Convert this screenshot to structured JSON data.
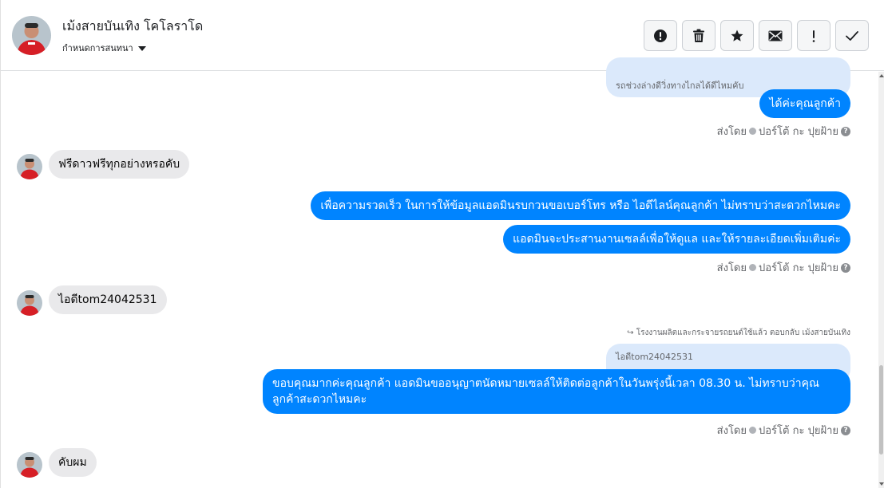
{
  "header": {
    "contact_name": "เม้งสายบันเทิง โคโลราโด",
    "assign_label": "กำหนดการสนทนา"
  },
  "toolbar": [
    {
      "icon": "alert-circle-icon",
      "name": "report-spam-button"
    },
    {
      "icon": "trash-icon",
      "name": "delete-button"
    },
    {
      "icon": "star-icon",
      "name": "star-button"
    },
    {
      "icon": "envelope-icon",
      "name": "mark-unread-button"
    },
    {
      "icon": "exclamation-icon",
      "name": "follow-up-button"
    },
    {
      "icon": "check-icon",
      "name": "mark-done-button"
    }
  ],
  "messages": {
    "quote_top": "รถช่วงล่างดีวิ่งทางไกลได้ดีไหมคับ",
    "out_1": "ได้ค่ะคุณลูกค้า",
    "in_1": "ฟรีดาวฟรีทุกอย่างหรอคับ",
    "out_2": "เพื่อความรวดเร็ว ในการให้ข้อมูลแอดมินรบกวนขอเบอร์โทร หรือ ไอดีไลน์คุณลูกค้า ไม่ทราบว่าสะดวกไหมคะ",
    "out_3": "แอดมินจะประสานงานเซลล์เพื่อให้ดูแล และให้รายละเอียดเพิ่มเติมค่ะ",
    "in_2": "ไอดีtom24042531",
    "reply_note": "โรงงานผลิตและกระจายรถยนต์ใช้แล้ว ตอบกลับ เม้งสายบันเทิง",
    "quote_2": "ไอดีtom24042531",
    "out_4": "ขอบคุณมากค่ะคุณลูกค้า แอดมินขออนุญาตนัดหมายเซลล์ให้ติดต่อลูกค้าในวันพรุ่งนี้เวลา 08.30 น. ไม่ทราบว่าคุณลูกค้าสะดวกไหมคะ",
    "in_3": "คับผม"
  },
  "sent_by": {
    "prefix": "ส่งโดย",
    "agent": "ปอร์โต้ กะ ปุยฝ้าย"
  },
  "colors": {
    "outgoing_bubble": "#0084ff",
    "incoming_bubble": "#e9e9eb",
    "quote_bubble": "#dbe9fb"
  }
}
